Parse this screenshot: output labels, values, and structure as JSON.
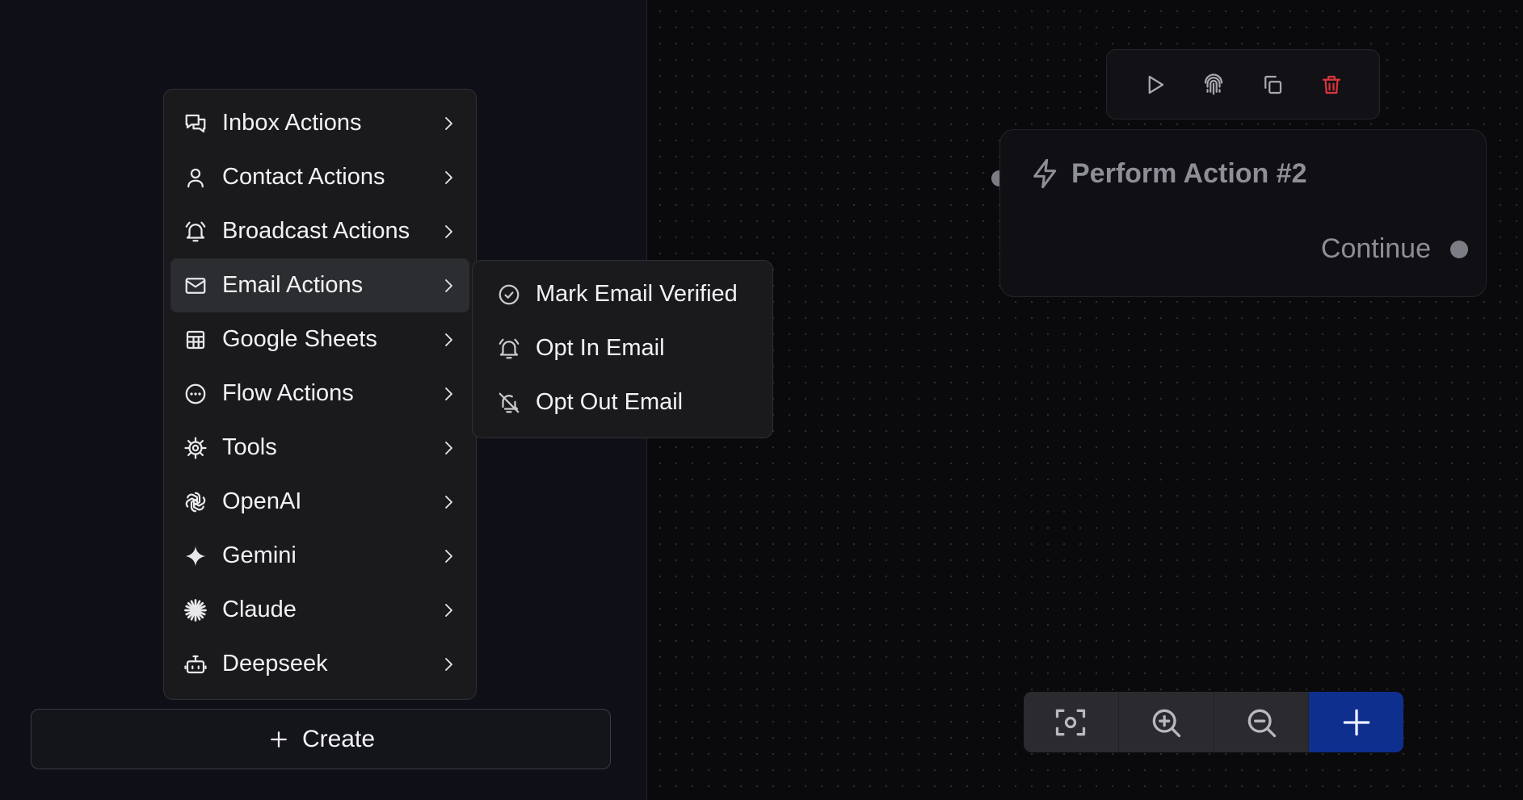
{
  "menu": {
    "items": [
      {
        "label": "Inbox Actions",
        "icon": "chat-bubbles-icon"
      },
      {
        "label": "Contact Actions",
        "icon": "user-icon"
      },
      {
        "label": "Broadcast Actions",
        "icon": "bell-ring-icon"
      },
      {
        "label": "Email Actions",
        "icon": "mail-icon",
        "active": true
      },
      {
        "label": "Google Sheets",
        "icon": "sheet-grid-icon"
      },
      {
        "label": "Flow Actions",
        "icon": "dots-circle-icon"
      },
      {
        "label": "Tools",
        "icon": "cog-icon"
      },
      {
        "label": "OpenAI",
        "icon": "openai-icon"
      },
      {
        "label": "Gemini",
        "icon": "sparkle-icon"
      },
      {
        "label": "Claude",
        "icon": "asterisk-burst-icon"
      },
      {
        "label": "Deepseek",
        "icon": "bot-icon"
      }
    ]
  },
  "submenu": {
    "items": [
      {
        "label": "Mark Email Verified",
        "icon": "check-circle-icon"
      },
      {
        "label": "Opt In Email",
        "icon": "bell-icon"
      },
      {
        "label": "Opt Out Email",
        "icon": "bell-off-icon"
      }
    ]
  },
  "create_button": {
    "label": "Create"
  },
  "node": {
    "title": "Perform Action #2",
    "output_label": "Continue"
  },
  "colors": {
    "accent": "#0f2f8f",
    "danger": "#d9343d",
    "menu_bg": "#1a1a1d",
    "active_item": "#2c2d31"
  }
}
